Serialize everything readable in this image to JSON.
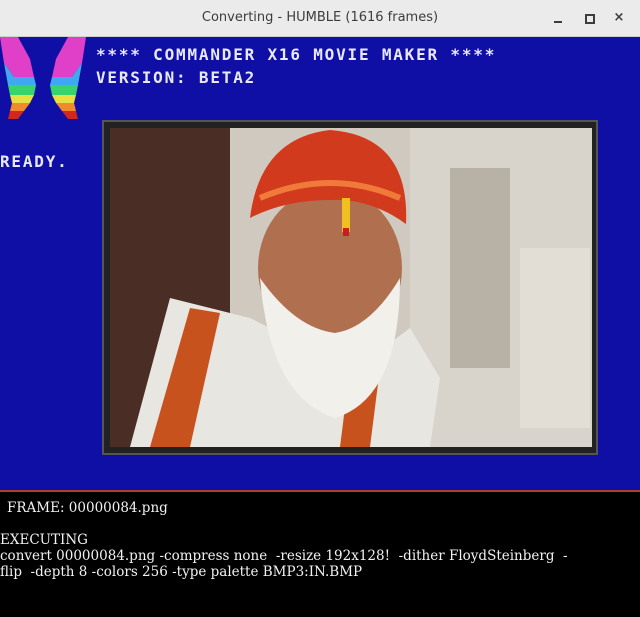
{
  "window": {
    "title": "Converting - HUMBLE (1616 frames)",
    "close_glyph": "×"
  },
  "screen": {
    "header_line1": "**** COMMANDER X16 MOVIE MAKER ****",
    "header_line2": "VERSION: BETA2",
    "ready": "READY.",
    "logo_icon": "commander-x16-butterfly-logo",
    "bg_color": "#0f0fa6"
  },
  "console": {
    "frame_line": "FRAME: 00000084.png",
    "status": "EXECUTING",
    "command_line1": "convert 00000084.png -compress none  -resize 192x128!  -dither FloydSteinberg  -",
    "command_line2": "flip  -depth 8 -colors 256 -type palette BMP3:IN.BMP"
  }
}
